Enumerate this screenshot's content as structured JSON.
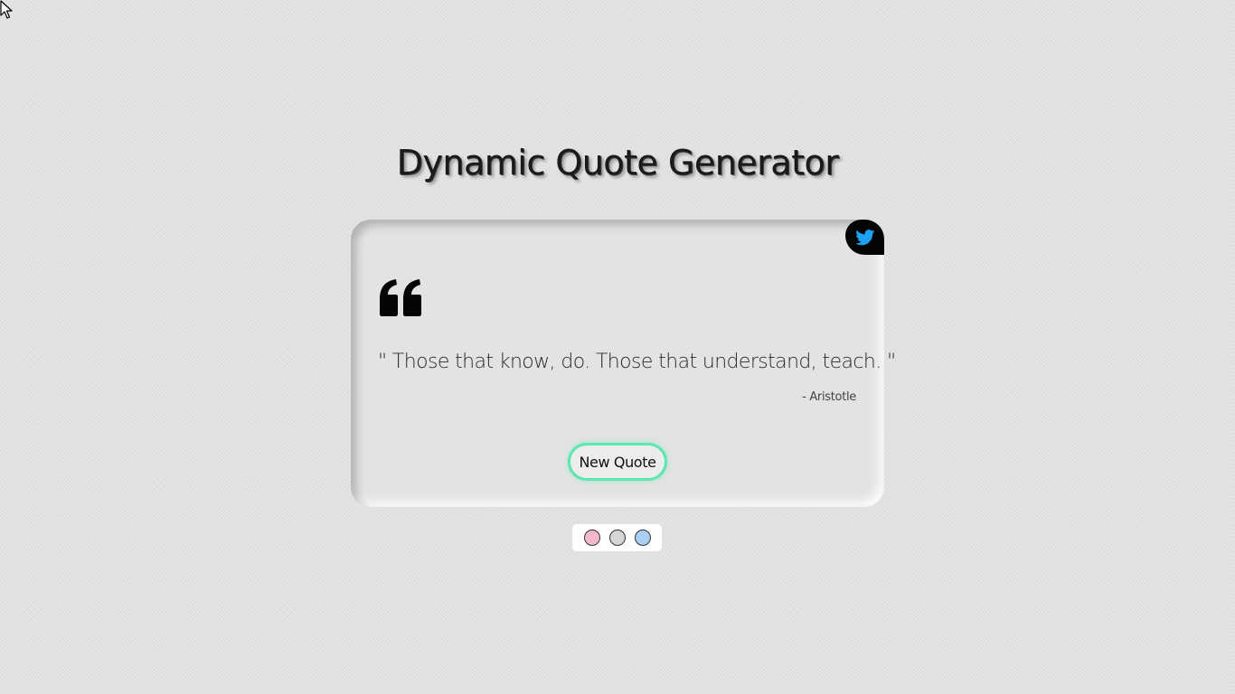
{
  "page": {
    "title": "Dynamic Quote Generator"
  },
  "quote": {
    "text": "\" Those that know, do. Those that understand, teach. \"",
    "author": "- Aristotle",
    "icon": "quote-left-icon"
  },
  "actions": {
    "new_quote_label": "New Quote",
    "tweet_icon": "twitter-icon"
  },
  "theme_picker": {
    "options": [
      {
        "name": "pink",
        "color": "#f4b8cc"
      },
      {
        "name": "gray",
        "color": "#d6d6d6"
      },
      {
        "name": "blue",
        "color": "#a9cff2"
      }
    ]
  },
  "colors": {
    "background": "#e2e2e2",
    "card": "#e3e3e3",
    "accent_button_border": "#5ce6b0",
    "twitter_icon": "#1da1f2",
    "twitter_button_bg": "#050505"
  }
}
